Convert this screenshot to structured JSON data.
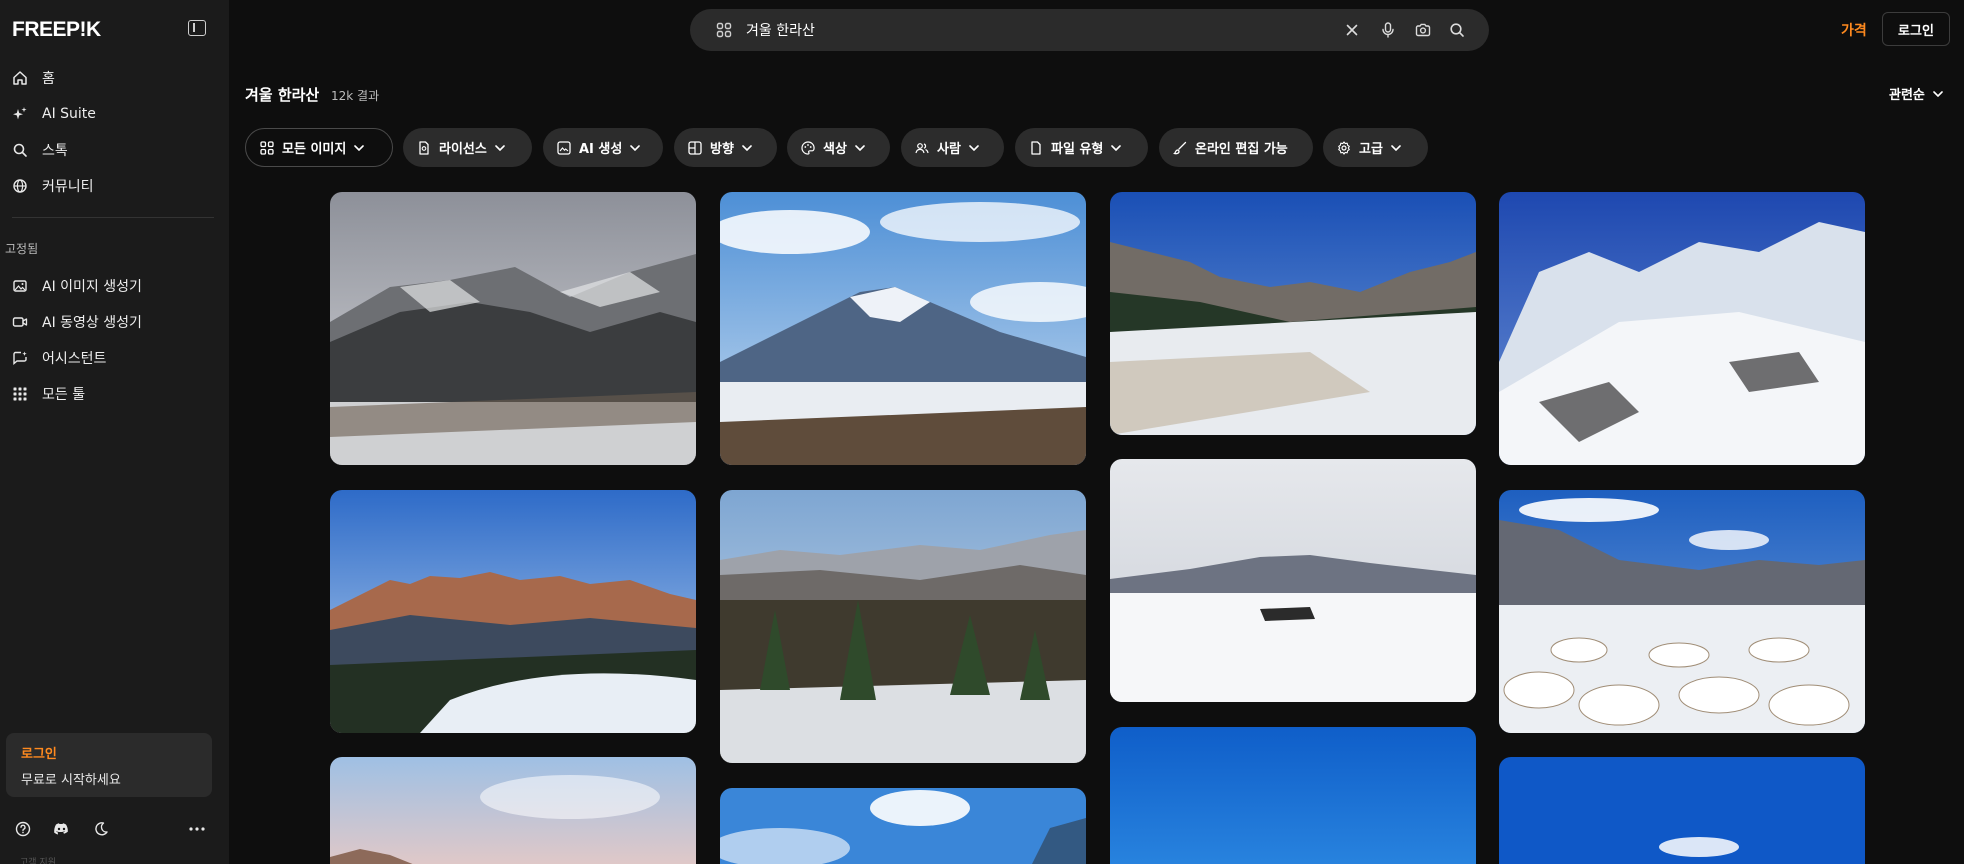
{
  "brand": {
    "logo": "FREEP!K"
  },
  "sidebar": {
    "nav": [
      {
        "label": "홈",
        "icon": "home-icon"
      },
      {
        "label": "AI Suite",
        "icon": "sparkle-icon"
      },
      {
        "label": "스톡",
        "icon": "search-icon"
      },
      {
        "label": "커뮤니티",
        "icon": "globe-icon"
      }
    ],
    "pinned_label": "고정됨",
    "pinned": [
      {
        "label": "AI 이미지 생성기",
        "icon": "image-icon"
      },
      {
        "label": "AI 동영상 생성기",
        "icon": "video-icon"
      },
      {
        "label": "어시스턴트",
        "icon": "assistant-icon"
      },
      {
        "label": "모든 툴",
        "icon": "grid-icon"
      }
    ],
    "login_card": {
      "title": "로그인",
      "subtitle": "무료로 시작하세요"
    },
    "bottom_text": "고객 지원"
  },
  "search": {
    "value": "겨울 한라산"
  },
  "header": {
    "pricing": "가격",
    "login": "로그인"
  },
  "results": {
    "title": "겨울 한라산",
    "count": "12k 결과",
    "sort": "관련순"
  },
  "filters": [
    {
      "label": "모든 이미지",
      "icon": "grid-icon"
    },
    {
      "label": "라이선스",
      "icon": "license-icon"
    },
    {
      "label": "AI 생성",
      "icon": "ai-image-icon"
    },
    {
      "label": "방향",
      "icon": "orientation-icon"
    },
    {
      "label": "색상",
      "icon": "palette-icon"
    },
    {
      "label": "사람",
      "icon": "people-icon"
    },
    {
      "label": "파일 유형",
      "icon": "file-icon"
    },
    {
      "label": "온라인 편집 가능",
      "icon": "brush-icon"
    },
    {
      "label": "고급",
      "icon": "settings-icon"
    }
  ],
  "colors": {
    "accent": "#ff8a1f",
    "sidebar_bg": "#1b1b1b",
    "page_bg": "#0e0e0e",
    "chip_bg": "#2c2c2c"
  }
}
